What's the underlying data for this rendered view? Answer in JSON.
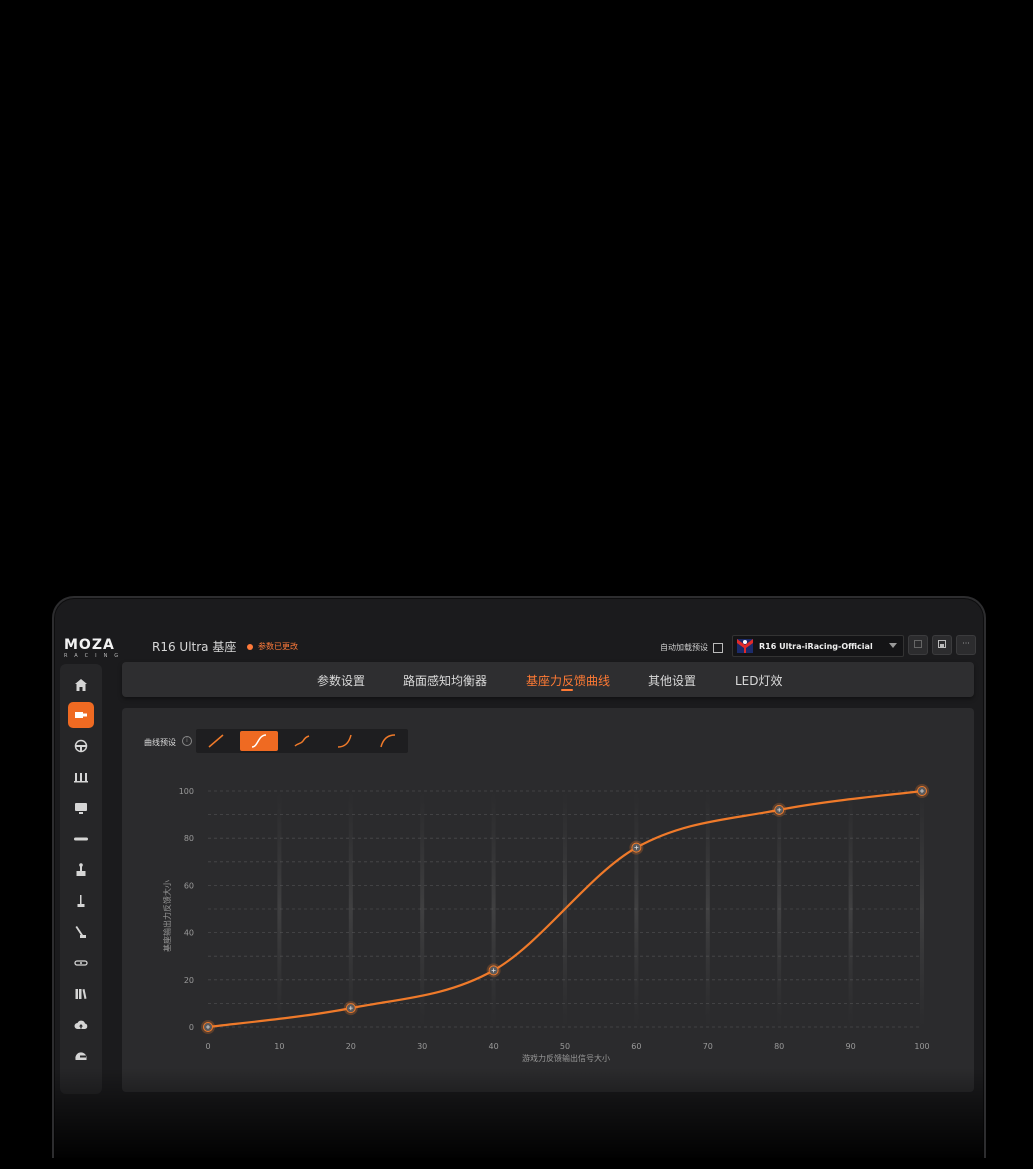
{
  "app": {
    "logo_main": "MOZA",
    "logo_sub": "RACING",
    "device_name": "R16 Ultra 基座",
    "changed_status": "参数已更改",
    "accent": "#ef6a22"
  },
  "toolbar": {
    "autoload_label": "自动加载预设",
    "autoload_checked": false,
    "preset_name": "R16 Ultra-iRacing-Official",
    "more_label": "···"
  },
  "sidebar": {
    "items": [
      {
        "icon": "home-icon",
        "active": false
      },
      {
        "icon": "wheelbase-icon",
        "active": true
      },
      {
        "icon": "steering-wheel-icon",
        "active": false
      },
      {
        "icon": "pedals-icon",
        "active": false
      },
      {
        "icon": "dashboard-display-icon",
        "active": false
      },
      {
        "icon": "led-bar-icon",
        "active": false
      },
      {
        "icon": "joystick-icon",
        "active": false
      },
      {
        "icon": "shifter-icon",
        "active": false
      },
      {
        "icon": "handbrake-icon",
        "active": false
      },
      {
        "icon": "hub-icon",
        "active": false
      },
      {
        "icon": "library-icon",
        "active": false
      },
      {
        "icon": "cloud-upload-icon",
        "active": false
      },
      {
        "icon": "helmet-icon",
        "active": false
      }
    ]
  },
  "tabs": [
    {
      "label": "参数设置",
      "active": false
    },
    {
      "label": "路面感知均衡器",
      "active": false
    },
    {
      "label": "基座力反馈曲线",
      "active": true
    },
    {
      "label": "其他设置",
      "active": false
    },
    {
      "label": "LED灯效",
      "active": false
    }
  ],
  "curve_presets": {
    "label": "曲线预设",
    "info_icon": "info-icon",
    "options": [
      {
        "shape": "linear-icon",
        "active": false
      },
      {
        "shape": "s-curve-icon",
        "active": true
      },
      {
        "shape": "soft-curve-icon",
        "active": false
      },
      {
        "shape": "exponential-curve-icon",
        "active": false
      },
      {
        "shape": "logarithmic-curve-icon",
        "active": false
      }
    ]
  },
  "chart_data": {
    "type": "line",
    "title": "",
    "xlabel": "游戏力反馈输出信号大小",
    "ylabel": "基座输出力反馈大小",
    "xlim": [
      0,
      100
    ],
    "ylim": [
      0,
      100
    ],
    "x_ticks": [
      "0",
      "10",
      "20",
      "30",
      "40",
      "50",
      "60",
      "70",
      "80",
      "90",
      "100"
    ],
    "y_ticks": [
      "0",
      "20",
      "40",
      "60",
      "80",
      "100"
    ],
    "grid": true,
    "points": [
      {
        "x": 0,
        "y": 0
      },
      {
        "x": 20,
        "y": 8
      },
      {
        "x": 40,
        "y": 24
      },
      {
        "x": 60,
        "y": 76
      },
      {
        "x": 80,
        "y": 92
      },
      {
        "x": 100,
        "y": 100
      }
    ],
    "line_color": "#ef7a2a"
  }
}
